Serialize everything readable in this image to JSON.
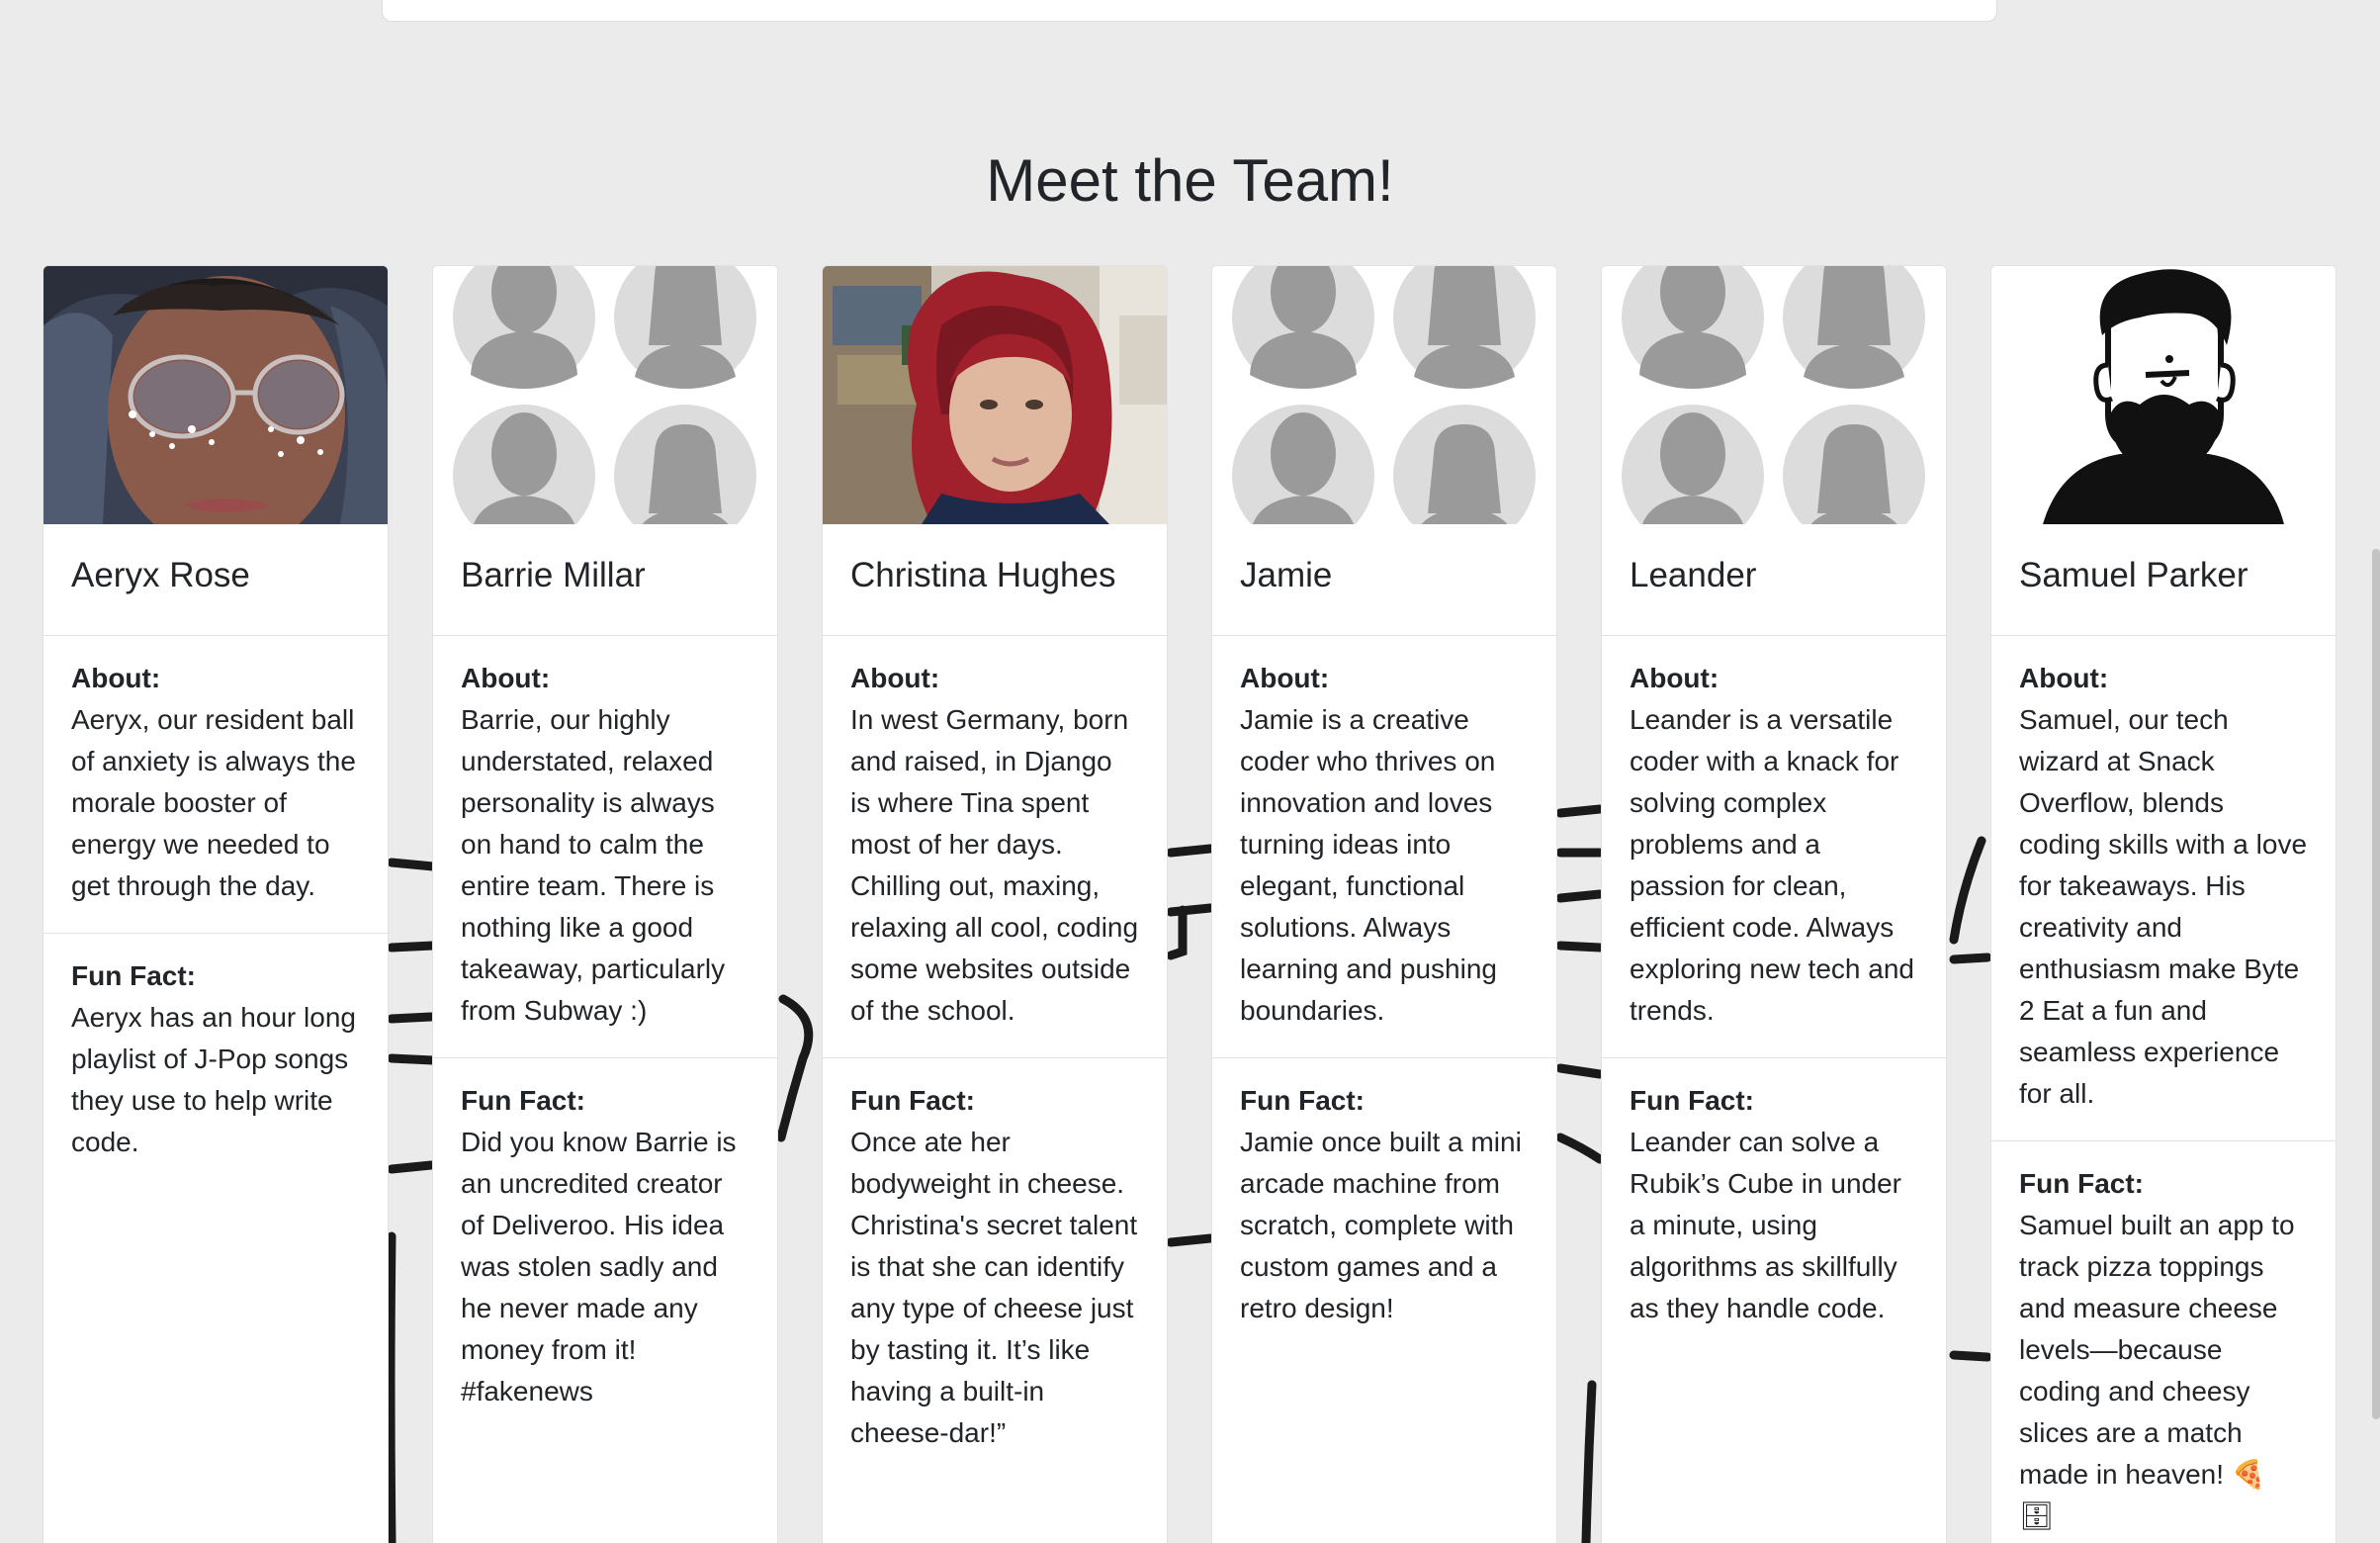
{
  "heading": "Meet the Team!",
  "colors": {
    "background": "#ebebeb",
    "card": "#ffffff",
    "text": "#212529",
    "placeholder_avatar": "#dcdcdc",
    "placeholder_silhouette": "#9a9a9a"
  },
  "team": [
    {
      "name": "Aeryx Rose",
      "image": "photo-aeryx",
      "about_label": "About:",
      "about": "Aeryx, our resident ball of anxiety is always the morale booster of energy we needed to get through the day.",
      "fun_label": "Fun Fact:",
      "fun": "Aeryx has an hour long playlist of J-Pop songs they use to help write code."
    },
    {
      "name": "Barrie Millar",
      "image": "placeholder-avatars",
      "about_label": "About:",
      "about": "Barrie, our highly understated, relaxed personality is always on hand to calm the entire team. There is nothing like a good takeaway, particularly from Subway :)",
      "fun_label": "Fun Fact:",
      "fun": "Did you know Barrie is an uncredited creator of Deliveroo. His idea was stolen sadly and he never made any money from it! #fakenews"
    },
    {
      "name": "Christina Hughes",
      "image": "photo-christina",
      "about_label": "About:",
      "about": "In west Germany, born and raised, in Django is where Tina spent most of her days. Chilling out, maxing, relaxing all cool, coding some websites outside of the school.",
      "fun_label": "Fun Fact:",
      "fun": "Once ate her bodyweight in cheese. Christina's secret talent is that she can identify any type of cheese just by tasting it. It’s like having a built-in cheese-dar!”"
    },
    {
      "name": "Jamie",
      "image": "placeholder-avatars",
      "about_label": "About:",
      "about": "Jamie is a creative coder who thrives on innovation and loves turning ideas into elegant, functional solutions. Always learning and pushing boundaries.",
      "fun_label": "Fun Fact:",
      "fun": "Jamie once built a mini arcade machine from scratch, complete with custom games and a retro design!"
    },
    {
      "name": "Leander",
      "image": "placeholder-avatars",
      "about_label": "About:",
      "about": "Leander is a versatile coder with a knack for solving complex problems and a passion for clean, efficient code. Always exploring new tech and trends.",
      "fun_label": "Fun Fact:",
      "fun": "Leander can solve a Rubik’s Cube in under a minute, using algorithms as skillfully as they handle code."
    },
    {
      "name": "Samuel Parker",
      "image": "illustration-samuel",
      "about_label": "About:",
      "about": "Samuel, our tech wizard at Snack Overflow, blends coding skills with a love for takeaways. His creativity and enthusiasm make Byte 2 Eat a fun and seamless experience for all.",
      "fun_label": "Fun Fact:",
      "fun": "Samuel built an app to track pizza toppings and measure cheese levels—because coding and cheesy slices are a match made in heaven! 🍕 🗄"
    }
  ]
}
